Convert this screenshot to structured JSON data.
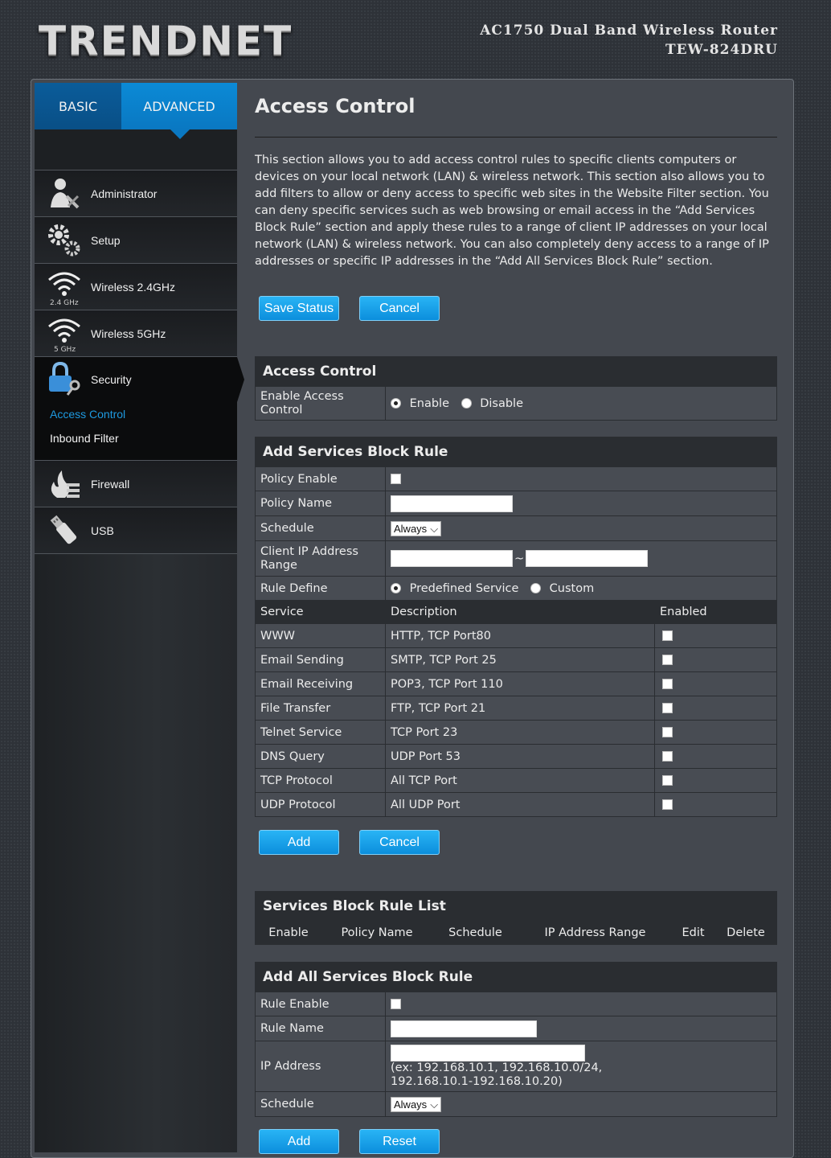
{
  "header": {
    "logo": "TRENDNET",
    "model_line1": "AC1750 Dual Band Wireless Router",
    "model_line2": "TEW-824DRU"
  },
  "tabs": {
    "basic": "BASIC",
    "advanced": "ADVANCED"
  },
  "nav": {
    "administrator": "Administrator",
    "setup": "Setup",
    "wireless24": "Wireless 2.4GHz",
    "wireless24_sub": "2.4 GHz",
    "wireless5": "Wireless 5GHz",
    "wireless5_sub": "5 GHz",
    "security": "Security",
    "access_control": "Access Control",
    "inbound_filter": "Inbound Filter",
    "firewall": "Firewall",
    "usb": "USB"
  },
  "page": {
    "title": "Access Control",
    "description": "This section allows you to add access control rules to specific clients computers or devices on your local network (LAN) & wireless network. This section also allows you to add filters to allow or deny access to specific web sites in the Website Filter section. You can deny specific services such as web browsing or email access in the “Add Services Block Rule” section and apply these rules to a range of client IP addresses on your local network (LAN) & wireless network. You can also completely deny access to a range of IP addresses or specific IP addresses in the “Add All Services Block Rule” section.",
    "save_status": "Save Status",
    "cancel": "Cancel"
  },
  "access_control": {
    "header": "Access Control",
    "enable_label": "Enable Access Control",
    "enable": "Enable",
    "disable": "Disable"
  },
  "services_block": {
    "header": "Add Services Block Rule",
    "policy_enable": "Policy Enable",
    "policy_name": "Policy Name",
    "schedule": "Schedule",
    "schedule_value": "Always",
    "client_ip_range": "Client IP Address Range",
    "tilde": "~",
    "rule_define": "Rule Define",
    "predefined": "Predefined Service",
    "custom": "Custom",
    "col_service": "Service",
    "col_description": "Description",
    "col_enabled": "Enabled",
    "rows": [
      {
        "service": "WWW",
        "desc": "HTTP, TCP Port80"
      },
      {
        "service": "Email Sending",
        "desc": "SMTP, TCP Port 25"
      },
      {
        "service": "Email Receiving",
        "desc": "POP3, TCP Port 110"
      },
      {
        "service": "File Transfer",
        "desc": "FTP, TCP Port 21"
      },
      {
        "service": "Telnet Service",
        "desc": "TCP Port 23"
      },
      {
        "service": "DNS Query",
        "desc": "UDP Port 53"
      },
      {
        "service": "TCP Protocol",
        "desc": "All TCP Port"
      },
      {
        "service": "UDP Protocol",
        "desc": "All UDP Port"
      }
    ],
    "add": "Add",
    "cancel": "Cancel"
  },
  "rule_list": {
    "header": "Services Block Rule List",
    "cols": [
      "Enable",
      "Policy Name",
      "Schedule",
      "IP Address Range",
      "Edit",
      "Delete"
    ]
  },
  "all_services": {
    "header": "Add All Services Block Rule",
    "rule_enable": "Rule Enable",
    "rule_name": "Rule Name",
    "ip_address": "IP Address",
    "ip_hint": "(ex: 192.168.10.1, 192.168.10.0/24, 192.168.10.1-192.168.10.20)",
    "schedule": "Schedule",
    "schedule_value": "Always",
    "add": "Add",
    "reset": "Reset"
  }
}
